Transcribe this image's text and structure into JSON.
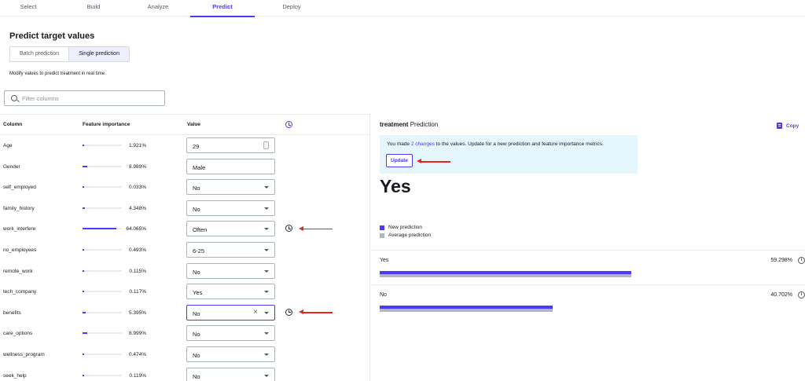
{
  "nav": {
    "tabs": [
      {
        "label": "Select"
      },
      {
        "label": "Build"
      },
      {
        "label": "Analyze"
      },
      {
        "label": "Predict",
        "active": true
      },
      {
        "label": "Deploy"
      }
    ]
  },
  "page": {
    "title": "Predict target values",
    "modes": [
      "Batch prediction",
      "Single prediction"
    ],
    "active_mode": "Single prediction",
    "subtitle": "Modify values to predict treatment in real time."
  },
  "filter": {
    "placeholder": "Filter columns",
    "value": ""
  },
  "table": {
    "headers": {
      "column": "Column",
      "importance": "Feature importance",
      "value": "Value"
    },
    "rows": [
      {
        "name": "Age",
        "importance": "1.921%",
        "importance_value": 1.921,
        "value": "29",
        "control": "number",
        "changed": false
      },
      {
        "name": "Gender",
        "importance": "8.989%",
        "importance_value": 8.989,
        "value": "Male",
        "control": "text",
        "changed": false
      },
      {
        "name": "self_employed",
        "importance": "0.033%",
        "importance_value": 0.033,
        "value": "No",
        "control": "select",
        "changed": false
      },
      {
        "name": "family_history",
        "importance": "4.348%",
        "importance_value": 4.348,
        "value": "No",
        "control": "select",
        "changed": false
      },
      {
        "name": "work_interfere",
        "importance": "64.065%",
        "importance_value": 64.065,
        "value": "Often",
        "control": "select",
        "changed": true
      },
      {
        "name": "no_employees",
        "importance": "0.493%",
        "importance_value": 0.493,
        "value": "6-25",
        "control": "select",
        "changed": false
      },
      {
        "name": "remote_work",
        "importance": "0.115%",
        "importance_value": 0.115,
        "value": "No",
        "control": "select",
        "changed": false
      },
      {
        "name": "tech_company",
        "importance": "0.117%",
        "importance_value": 0.117,
        "value": "Yes",
        "control": "select",
        "changed": false
      },
      {
        "name": "benefits",
        "importance": "5.395%",
        "importance_value": 5.395,
        "value": "No",
        "control": "select-focused",
        "changed": true
      },
      {
        "name": "care_options",
        "importance": "8.999%",
        "importance_value": 8.999,
        "value": "No",
        "control": "select",
        "changed": false
      },
      {
        "name": "wellness_program",
        "importance": "0.474%",
        "importance_value": 0.474,
        "value": "No",
        "control": "select",
        "changed": false
      },
      {
        "name": "seek_help",
        "importance": "0.119%",
        "importance_value": 0.119,
        "value": "No",
        "control": "select",
        "changed": false
      }
    ]
  },
  "prediction": {
    "target": "treatment",
    "title_suffix": "Prediction",
    "copy_label": "Copy",
    "alert": {
      "prefix": "You made ",
      "link": "2 changes",
      "suffix": " to the values. Update for a new prediction and feature importance metrics.",
      "button": "Update"
    },
    "result": "Yes",
    "legend": [
      {
        "label": "New prediction",
        "color": "#4a3aff"
      },
      {
        "label": "Average prediction",
        "color": "#b3b8c0"
      }
    ],
    "classes": [
      {
        "label": "Yes",
        "pct": "59.298%",
        "new_value": 59.298,
        "avg_value": 59.298
      },
      {
        "label": "No",
        "pct": "40.702%",
        "new_value": 40.702,
        "avg_value": 40.702
      }
    ]
  },
  "colors": {
    "accent": "#4a3aff",
    "annotation_arrow": "#e8261d",
    "alert_bg": "#e5f6fd"
  }
}
